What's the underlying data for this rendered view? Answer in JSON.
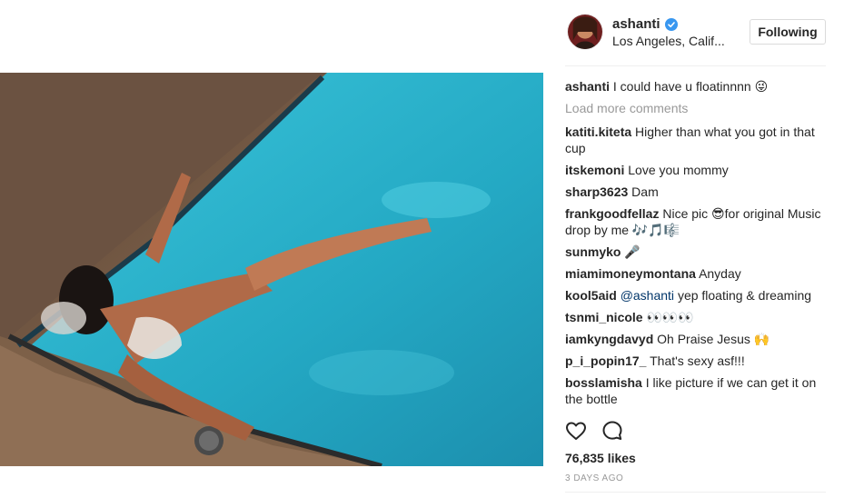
{
  "post": {
    "username": "ashanti",
    "location": "Los Angeles, Calif...",
    "follow_label": "Following",
    "caption_user": "ashanti",
    "caption_text": "I could have u floatinnnn 😜",
    "load_more": "Load more comments",
    "likes": "76,835 likes",
    "timestamp": "3 DAYS AGO"
  },
  "comments": [
    {
      "user": "katiti.kiteta",
      "text": "Higher than what you got in that cup"
    },
    {
      "user": "itskemoni",
      "text": "Love you mommy"
    },
    {
      "user": "sharp3623",
      "text": "Dam"
    },
    {
      "user": "frankgoodfellaz",
      "text": "Nice pic 😎for original Music drop by me 🎶🎵🎼"
    },
    {
      "user": "sunmyko",
      "text": "🎤"
    },
    {
      "user": "miamimoneymontana",
      "text": "Anyday"
    },
    {
      "user": "kool5aid",
      "mention": "@ashanti",
      "text": "yep floating & dreaming"
    },
    {
      "user": "tsnmi_nicole",
      "text": "👀👀👀"
    },
    {
      "user": "iamkyngdavyd",
      "text": "Oh Praise Jesus 🙌"
    },
    {
      "user": "p_i_popin17_",
      "text": "That's sexy asf!!!"
    },
    {
      "user": "bosslamisha",
      "text": "I like picture if we can get it on the bottle"
    }
  ],
  "icons": {
    "verified": "verified-badge-icon",
    "like": "heart-icon",
    "comment": "comment-bubble-icon"
  },
  "colors": {
    "verified_blue": "#3897f0",
    "pool_blue": "#2fb3cc",
    "mention_blue": "#003569"
  }
}
